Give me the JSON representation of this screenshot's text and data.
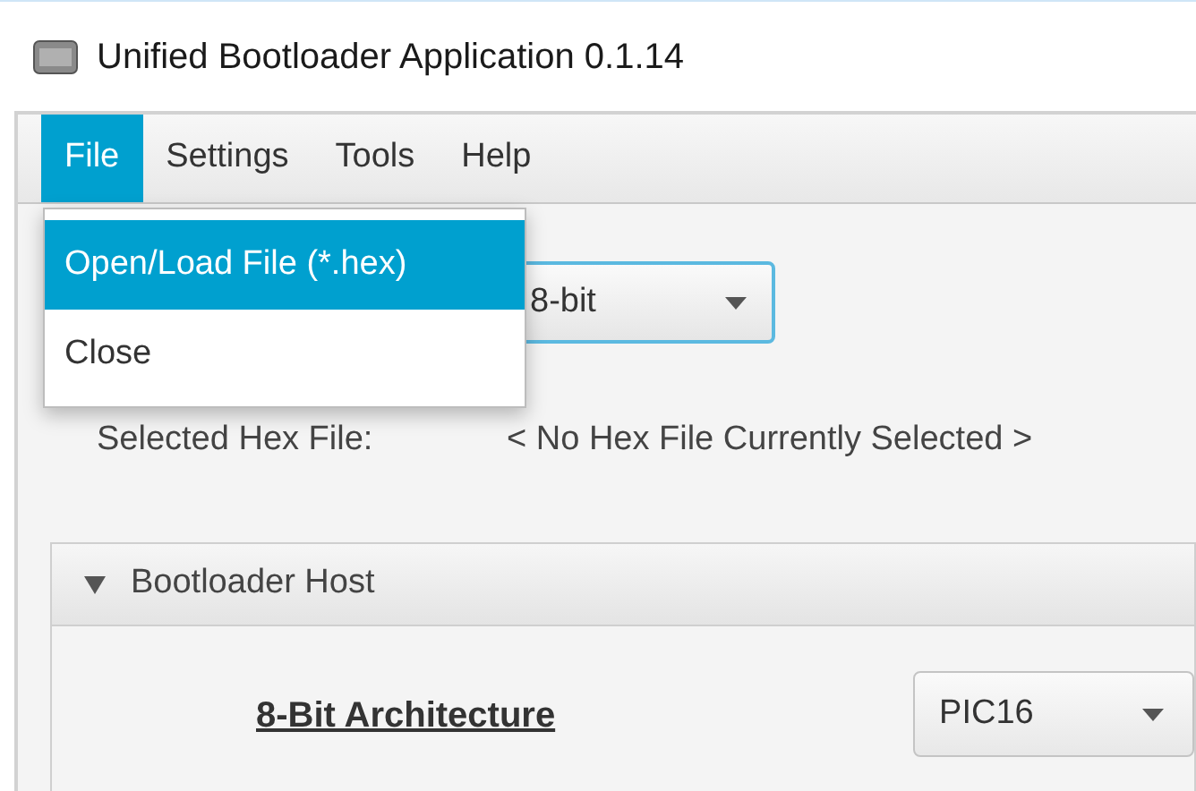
{
  "window": {
    "title": "Unified Bootloader Application 0.1.14"
  },
  "menu_bar": [
    {
      "label": "File",
      "selected": true
    },
    {
      "label": "Settings",
      "selected": false
    },
    {
      "label": "Tools",
      "selected": false
    },
    {
      "label": "Help",
      "selected": false
    }
  ],
  "open_menu": [
    {
      "label": "Open/Load File (*.hex)",
      "selected": true
    },
    {
      "label": "Close",
      "selected": false
    }
  ],
  "device_combo": {
    "value": "8-bit"
  },
  "hex_file": {
    "label": "Selected Hex File:",
    "value": "< No Hex File Currently Selected >"
  },
  "pane": {
    "title": "Bootloader Host",
    "expanded": true,
    "architecture_label": "8-Bit Architecture",
    "family_combo": {
      "value": "PIC16"
    }
  }
}
